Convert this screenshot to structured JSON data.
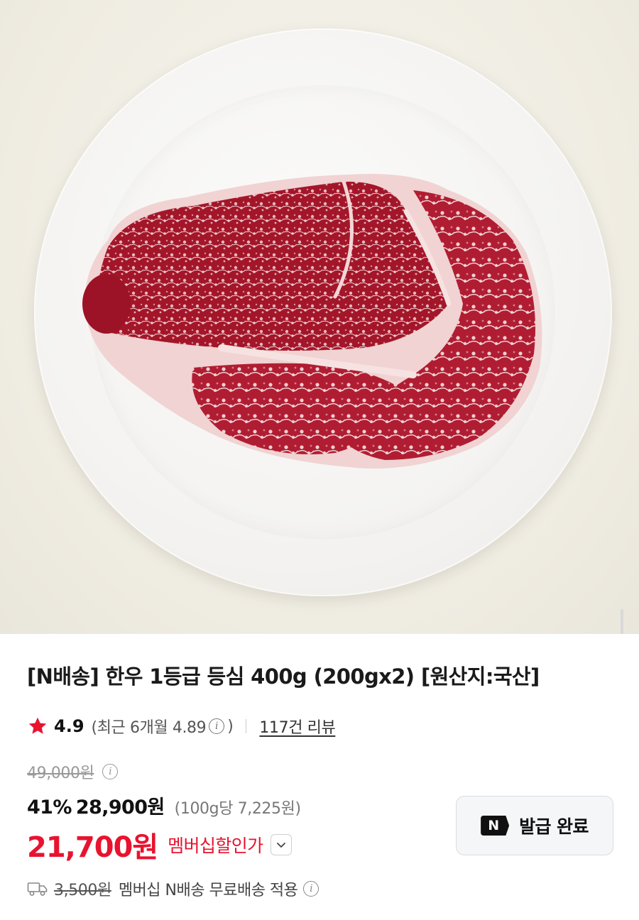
{
  "product": {
    "title": "[N배송] 한우 1등급 등심 400g (200gx2) [원산지:국산]"
  },
  "rating": {
    "score": "4.9",
    "recent": "(최근 6개월 4.89",
    "recent_close": ")",
    "review_link": "117건 리뷰"
  },
  "price": {
    "original": "49,000원",
    "discount_rate": "41%",
    "sale": "28,900원",
    "unit": "(100g당 7,225원)",
    "member": "21,700원",
    "member_label": "멤버십할인가"
  },
  "coupon": {
    "badge": "N",
    "label": "발급 완료"
  },
  "shipping": {
    "original_fee": "3,500원",
    "text": "멤버십 N배송 무료배송 적용"
  },
  "icons": {
    "rating": "star-icon",
    "info": "info-icon",
    "dropdown": "chevron-down-icon",
    "shipping": "truck-icon",
    "membership": "n-badge-icon"
  },
  "colors": {
    "accent_red": "#e8132f",
    "star": "#e8132f",
    "badge": "#111111"
  }
}
